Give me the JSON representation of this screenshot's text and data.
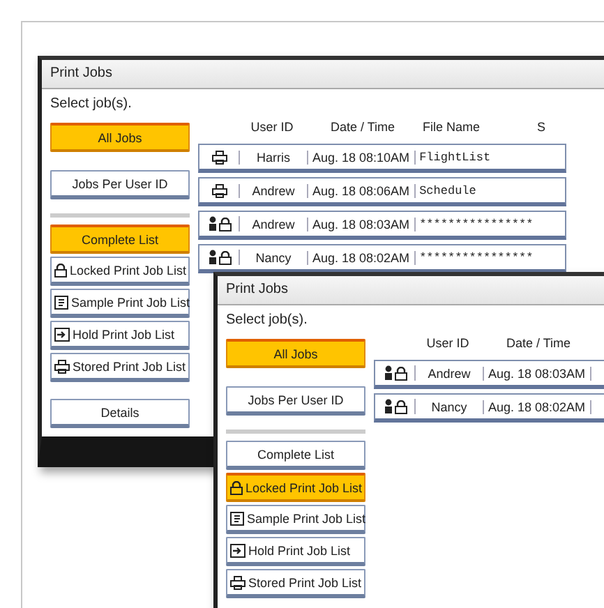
{
  "windows": [
    {
      "title": "Print Jobs",
      "prompt": "Select job(s).",
      "view_buttons": [
        {
          "label": "All Jobs",
          "selected": true
        },
        {
          "label": "Jobs Per User ID",
          "selected": false
        }
      ],
      "list_buttons": [
        {
          "label": "Complete List",
          "kind": "plain",
          "selected": true
        },
        {
          "label": "Locked Print Job List",
          "kind": "locked",
          "selected": false
        },
        {
          "label": "Sample Print Job List",
          "kind": "sample",
          "selected": false
        },
        {
          "label": "Hold Print Job List",
          "kind": "hold",
          "selected": false
        },
        {
          "label": "Stored Print Job List",
          "kind": "stored",
          "selected": false
        }
      ],
      "details_button": "Details",
      "columns": [
        "User ID",
        "Date / Time",
        "File Name",
        "S"
      ],
      "rows": [
        {
          "kind": "stored",
          "user": "Harris",
          "time": "Aug. 18 08:10AM",
          "file": "FlightList"
        },
        {
          "kind": "stored",
          "user": "Andrew",
          "time": "Aug. 18 08:06AM",
          "file": "Schedule"
        },
        {
          "kind": "locked",
          "user": "Andrew",
          "time": "Aug. 18 08:03AM",
          "file": "****************"
        },
        {
          "kind": "locked",
          "user": "Nancy",
          "time": "Aug. 18 08:02AM",
          "file": "****************"
        }
      ]
    },
    {
      "title": "Print Jobs",
      "prompt": "Select job(s).",
      "view_buttons": [
        {
          "label": "All Jobs",
          "selected": true
        },
        {
          "label": "Jobs Per User ID",
          "selected": false
        }
      ],
      "list_buttons": [
        {
          "label": "Complete List",
          "kind": "plain",
          "selected": false
        },
        {
          "label": "Locked Print Job List",
          "kind": "locked",
          "selected": true
        },
        {
          "label": "Sample Print Job List",
          "kind": "sample",
          "selected": false
        },
        {
          "label": "Hold Print Job List",
          "kind": "hold",
          "selected": false
        },
        {
          "label": "Stored Print Job List",
          "kind": "stored",
          "selected": false
        }
      ],
      "columns": [
        "User ID",
        "Date / Time"
      ],
      "rows": [
        {
          "kind": "locked",
          "user": "Andrew",
          "time": "Aug. 18 08:03AM"
        },
        {
          "kind": "locked",
          "user": "Nancy",
          "time": "Aug. 18 08:02AM"
        }
      ]
    }
  ]
}
